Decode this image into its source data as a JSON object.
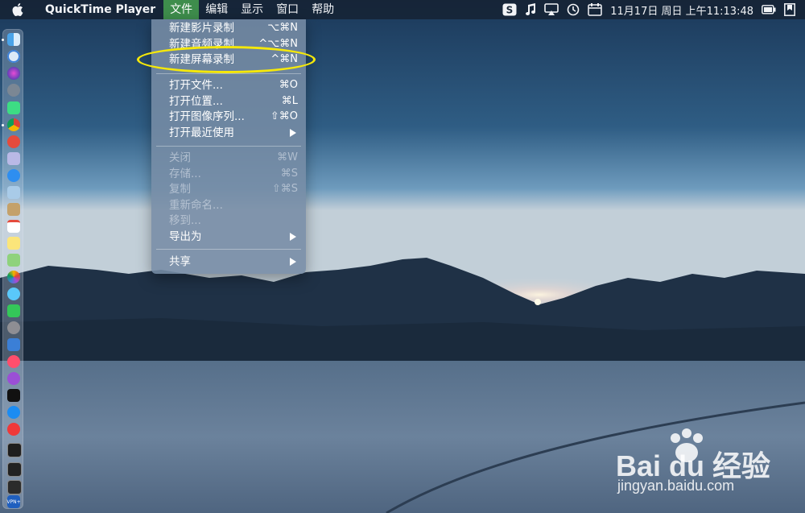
{
  "menubar": {
    "app_name": "QuickTime Player",
    "menus": [
      {
        "label": "文件",
        "active": true
      },
      {
        "label": "编辑"
      },
      {
        "label": "显示"
      },
      {
        "label": "窗口"
      },
      {
        "label": "帮助"
      }
    ],
    "clock": "11月17日 周日 上午11:13:48"
  },
  "file_menu": {
    "groups": [
      [
        {
          "label": "新建影片录制",
          "shortcut": "⌥⌘N"
        },
        {
          "label": "新建音频录制",
          "shortcut": "^⌥⌘N"
        },
        {
          "label": "新建屏幕录制",
          "shortcut": "^⌘N"
        }
      ],
      [
        {
          "label": "打开文件...",
          "shortcut": "⌘O"
        },
        {
          "label": "打开位置...",
          "shortcut": "⌘L"
        },
        {
          "label": "打开图像序列...",
          "shortcut": "⇧⌘O"
        },
        {
          "label": "打开最近使用",
          "submenu": true
        }
      ],
      [
        {
          "label": "关闭",
          "shortcut": "⌘W",
          "disabled": true
        },
        {
          "label": "存储...",
          "shortcut": "⌘S",
          "disabled": true
        },
        {
          "label": "复制",
          "shortcut": "⇧⌘S",
          "disabled": true
        },
        {
          "label": "重新命名...",
          "disabled": true
        },
        {
          "label": "移到...",
          "disabled": true
        },
        {
          "label": "导出为",
          "submenu": true
        }
      ],
      [
        {
          "label": "共享",
          "submenu": true
        }
      ]
    ]
  },
  "dock": {
    "vpn_label": "VPN+"
  },
  "watermark": {
    "brand": "Bai du 经验",
    "url": "jingyan.baidu.com"
  },
  "colors": {
    "menu_active": "#3e8d4c",
    "highlight": "#f5e80a"
  }
}
